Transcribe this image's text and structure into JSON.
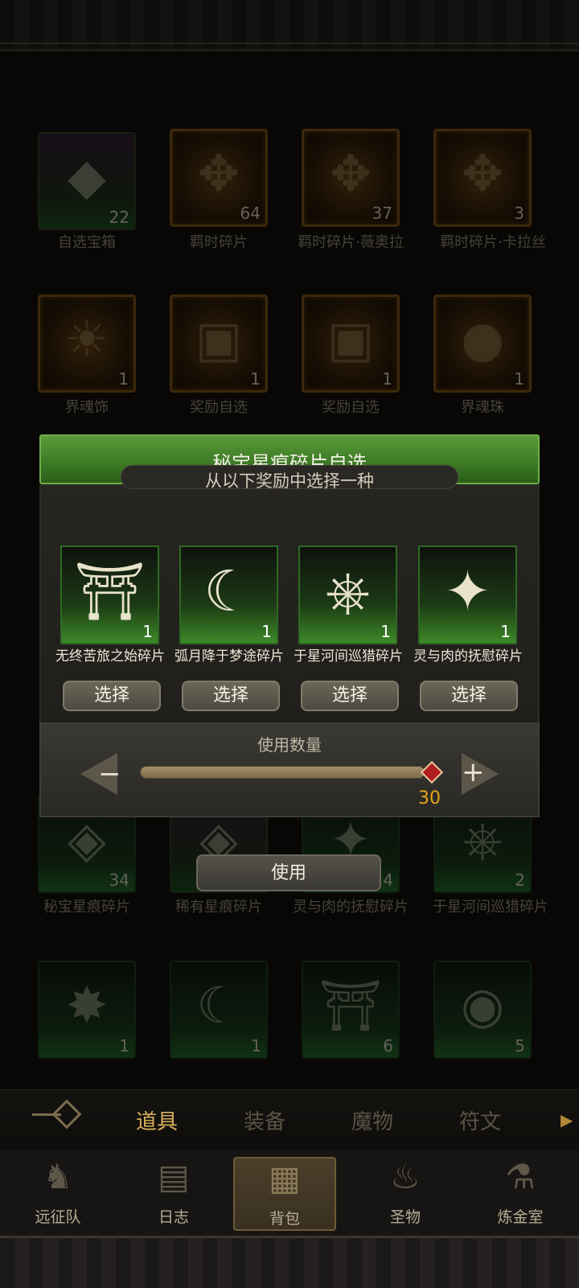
{
  "inventory": {
    "row1": [
      {
        "label": "自选宝箱",
        "count": "22",
        "icon": "purple-chest-icon"
      },
      {
        "label": "羁时碎片",
        "count": "64",
        "icon": "puzzle-question-icon"
      },
      {
        "label": "羁时碎片·薇奥拉",
        "count": "37",
        "icon": "puzzle-piece-icon"
      },
      {
        "label": "羁时碎片·卡拉丝",
        "count": "3",
        "icon": "puzzle-piece-icon"
      }
    ],
    "row2": [
      {
        "label": "界魂饰",
        "count": "1",
        "icon": "sun-mask-icon"
      },
      {
        "label": "奖励自选",
        "count": "1",
        "icon": "treasure-chest-icon"
      },
      {
        "label": "奖励自选",
        "count": "1",
        "icon": "treasure-chest-icon"
      },
      {
        "label": "界魂珠",
        "count": "1",
        "icon": "orb-icon"
      }
    ],
    "row3": [
      {
        "label": "秘宝星痕碎片",
        "count": "34",
        "icon": "green-shard-icon"
      },
      {
        "label": "稀有星痕碎片",
        "count": "",
        "icon": "purple-shard-icon"
      },
      {
        "label": "灵与肉的抚慰碎片",
        "count": "4",
        "icon": "feather-blade-icon"
      },
      {
        "label": "于星河间巡猎碎片",
        "count": "2",
        "icon": "chariot-icon"
      }
    ],
    "row4": [
      {
        "label": "",
        "count": "1",
        "icon": "star-burst-icon"
      },
      {
        "label": "",
        "count": "1",
        "icon": "moon-ring-icon"
      },
      {
        "label": "",
        "count": "6",
        "icon": "gate-icon"
      },
      {
        "label": "",
        "count": "5",
        "icon": "eye-ring-icon"
      }
    ]
  },
  "dialog": {
    "title": "秘宝星痕碎片自选",
    "instruction": "从以下奖励中选择一种",
    "choices": [
      {
        "label": "无终苦旅之始碎片",
        "count": "1",
        "icon": "gate-icon",
        "button": "选择"
      },
      {
        "label": "弧月降于梦途碎片",
        "count": "1",
        "icon": "moon-ring-icon",
        "button": "选择"
      },
      {
        "label": "于星河间巡猎碎片",
        "count": "1",
        "icon": "chariot-icon",
        "button": "选择"
      },
      {
        "label": "灵与肉的抚慰碎片",
        "count": "1",
        "icon": "feather-blade-icon",
        "button": "选择"
      }
    ],
    "quantity_label": "使用数量",
    "quantity_value": "30",
    "quantity_fill": 0.98,
    "minus_sign": "−",
    "plus_sign": "+"
  },
  "use_button": "使用",
  "tabs": [
    {
      "label": "道具",
      "active": true
    },
    {
      "label": "装备",
      "active": false
    },
    {
      "label": "魔物",
      "active": false
    },
    {
      "label": "符文",
      "active": false
    }
  ],
  "nav": [
    {
      "label": "远征队",
      "icon": "horned-helmet-icon"
    },
    {
      "label": "日志",
      "icon": "scroll-icon"
    },
    {
      "label": "背包",
      "icon": "backpack-icon",
      "active": true
    },
    {
      "label": "圣物",
      "icon": "torch-icon"
    },
    {
      "label": "炼金室",
      "icon": "alchemy-icon"
    }
  ],
  "colors": {
    "accent_green": "#4f8d30",
    "gold": "#e4a51c",
    "thumb_red": "#b01d1d"
  }
}
